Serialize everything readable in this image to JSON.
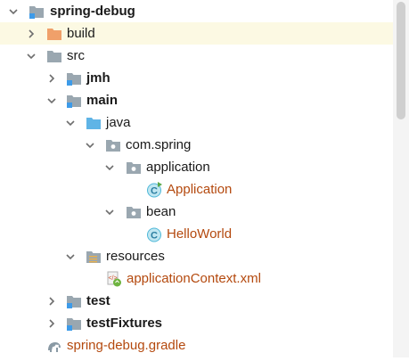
{
  "colors": {
    "highlight_row": "#fcf9e3",
    "folder_gray": "#9aa7b0",
    "folder_orange": "#f0a06a",
    "folder_source_blue": "#5fb4e6",
    "module_marker_blue": "#3d9be9",
    "class_text": "#b4490e",
    "class_icon_teal": "#4fb8d8"
  },
  "tree": {
    "items": [
      {
        "label": "spring-debug",
        "icon": "module-folder-icon",
        "expanded": true
      },
      {
        "label": "build",
        "icon": "excluded-folder-icon",
        "expanded": false
      },
      {
        "label": "src",
        "icon": "folder-icon",
        "expanded": true
      },
      {
        "label": "jmh",
        "icon": "module-folder-icon",
        "expanded": false
      },
      {
        "label": "main",
        "icon": "module-folder-icon",
        "expanded": true
      },
      {
        "label": "java",
        "icon": "source-folder-icon",
        "expanded": true
      },
      {
        "label": "com.spring",
        "icon": "package-icon",
        "expanded": true
      },
      {
        "label": "application",
        "icon": "package-icon",
        "expanded": true
      },
      {
        "label": "Application",
        "icon": "java-class-runnable-icon"
      },
      {
        "label": "bean",
        "icon": "package-icon",
        "expanded": true
      },
      {
        "label": "HelloWorld",
        "icon": "java-class-icon"
      },
      {
        "label": "resources",
        "icon": "resources-folder-icon",
        "expanded": true
      },
      {
        "label": "applicationContext.xml",
        "icon": "spring-xml-icon"
      },
      {
        "label": "test",
        "icon": "module-folder-icon",
        "expanded": false
      },
      {
        "label": "testFixtures",
        "icon": "module-folder-icon",
        "expanded": false
      },
      {
        "label": "spring-debug.gradle",
        "icon": "gradle-elephant-icon"
      }
    ]
  }
}
